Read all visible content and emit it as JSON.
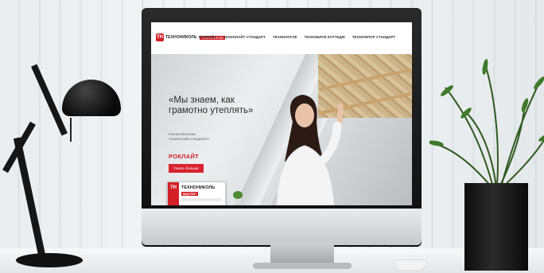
{
  "site": {
    "logo_mark": "ТН",
    "logo_text": "ТЕХНОНИКОЛЬ",
    "logo_tag": "ТЕХНОЛОГИИ",
    "nav": [
      "РОКЛАЙТ",
      "ТЕХНОЛАЙТ СТАНДАРТ",
      "ТЕХНОЛОГИК",
      "ТЕХНОБЛОК КОТТЕДЖ",
      "ТЕХНОФЛОР СТАНДАРТ"
    ],
    "hero_title": "«Мы знаем, как грамотно утеплять»",
    "hero_sub": "Ксения Волкова, технический специалист",
    "hero_brand": "РОКЛАЙТ",
    "hero_button": "Узнать больше",
    "product_name": "ТЕХНОНИКОЛЬ",
    "product_sub": "МАСТЕР",
    "slides_count": 5,
    "active_slide": 1
  },
  "colors": {
    "brand_red": "#d32027",
    "monitor_bezel": "#111111",
    "lamp": "#111111"
  }
}
